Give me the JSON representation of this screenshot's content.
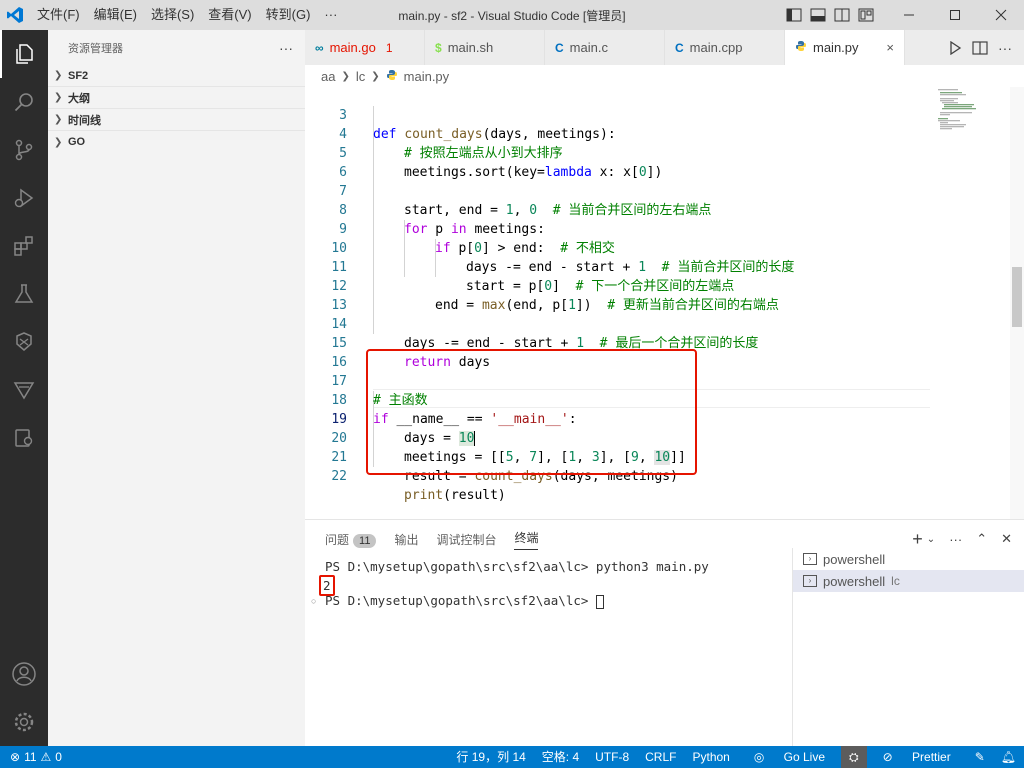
{
  "window": {
    "title": "main.py - sf2 - Visual Studio Code [管理员]",
    "menus": [
      "文件(F)",
      "编辑(E)",
      "选择(S)",
      "查看(V)",
      "转到(G)",
      "···"
    ]
  },
  "sidebar": {
    "title": "资源管理器",
    "more": "···",
    "sections": [
      "SF2",
      "大纲",
      "时间线",
      "GO"
    ]
  },
  "tabs": [
    {
      "icon": "∞",
      "icon_color": "#007d9c",
      "label": "main.go",
      "badge": "1",
      "label_color": "#e51400"
    },
    {
      "icon": "$",
      "icon_color": "#89e051",
      "label": "main.sh"
    },
    {
      "icon": "C",
      "icon_color": "#0070c0",
      "label": "main.c"
    },
    {
      "icon": "C",
      "icon_color": "#0070c0",
      "label": "main.cpp"
    },
    {
      "icon": "py",
      "icon_color": "#3572a5",
      "label": "main.py",
      "close": "×"
    }
  ],
  "breadcrumb": [
    "aa",
    "lc",
    "main.py"
  ],
  "code": {
    "line_numbers": [
      "3",
      "4",
      "5",
      "6",
      "7",
      "8",
      "9",
      "10",
      "11",
      "12",
      "13",
      "14",
      "15",
      "16",
      "17",
      "18",
      "19",
      "20",
      "21",
      "22"
    ],
    "l3": {
      "def": "def",
      "fn": "count_days",
      "rest": "(days, meetings):"
    },
    "l4": {
      "cmt": "# 按照左端点从小到大排序"
    },
    "l5": {
      "a": "meetings.sort(key=",
      "lambda": "lambda",
      "b": " x: x[",
      "n": "0",
      "c": "])"
    },
    "l7": {
      "a": "start, end = ",
      "n1": "1",
      "b": ", ",
      "n2": "0",
      "c": "  ",
      "cmt": "# 当前合并区间的左右端点"
    },
    "l8": {
      "for": "for",
      "a": " p ",
      "in": "in",
      "b": " meetings:"
    },
    "l9": {
      "if": "if",
      "a": " p[",
      "n": "0",
      "b": "] > end:  ",
      "cmt": "# 不相交"
    },
    "l10": {
      "a": "days -= end - start + ",
      "n": "1",
      "b": "  ",
      "cmt": "# 当前合并区间的长度"
    },
    "l11": {
      "a": "start = p[",
      "n": "0",
      "b": "]  ",
      "cmt": "# 下一个合并区间的左端点"
    },
    "l12": {
      "a": "end = ",
      "fn": "max",
      "b": "(end, p[",
      "n": "1",
      "c": "])  ",
      "cmt": "# 更新当前合并区间的右端点"
    },
    "l14": {
      "a": "days -= end - start + ",
      "n": "1",
      "b": "  ",
      "cmt": "# 最后一个合并区间的长度"
    },
    "l15": {
      "ret": "return",
      "a": " days"
    },
    "l17": {
      "cmt": "# 主函数"
    },
    "l18": {
      "if": "if",
      "a": " __name__ == ",
      "s": "'__main__'",
      "b": ":"
    },
    "l19": {
      "a": "days = ",
      "n": "10"
    },
    "l20": {
      "a": "meetings = [[",
      "n1": "5",
      "b": ", ",
      "n2": "7",
      "c": "], [",
      "n3": "1",
      "d": ", ",
      "n4": "3",
      "e": "], [",
      "n5": "9",
      "f": ", ",
      "n6": "10",
      "g": "]]"
    },
    "l21": {
      "a": "result = ",
      "fn": "count_days",
      "b": "(days, meetings)"
    },
    "l22": {
      "fn": "print",
      "a": "(result)"
    }
  },
  "panel": {
    "tabs": [
      {
        "label": "问题",
        "badge": "11"
      },
      {
        "label": "输出"
      },
      {
        "label": "调试控制台"
      },
      {
        "label": "终端"
      }
    ],
    "terminal": [
      "PS D:\\mysetup\\gopath\\src\\sf2\\aa\\lc> python3 main.py",
      "2",
      "PS D:\\mysetup\\gopath\\src\\sf2\\aa\\lc> "
    ],
    "terminals": [
      {
        "name": "powershell",
        "sub": ""
      },
      {
        "name": "powershell",
        "sub": "lc"
      }
    ]
  },
  "status": {
    "errors": "11",
    "warnings": "0",
    "position": "行 19，列 14",
    "indent": "空格: 4",
    "encoding": "UTF-8",
    "eol": "CRLF",
    "language": "Python",
    "golive": "Go Live",
    "prettier": "Prettier"
  },
  "colors": {
    "accent": "#007acc",
    "highlight_box": "#e51400"
  }
}
